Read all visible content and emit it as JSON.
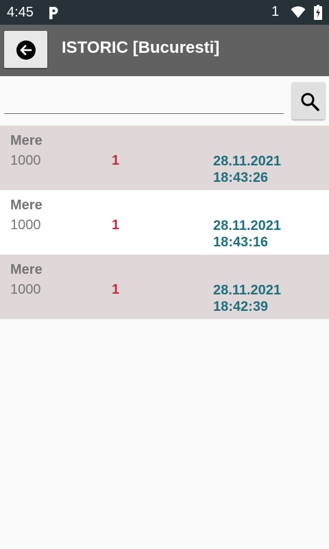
{
  "status_bar": {
    "time": "4:45",
    "sim_label": "1",
    "icons": [
      "p-icon",
      "wifi-icon",
      "battery-icon"
    ]
  },
  "app_bar": {
    "title": "ISTORIC [Bucuresti]",
    "back_icon": "arrow-left-circle-icon"
  },
  "search": {
    "value": "",
    "placeholder": "",
    "button_icon": "search-icon"
  },
  "history": [
    {
      "name": "Mere",
      "code": "1000",
      "qty": "1",
      "date": "28.11.2021",
      "time": "18:43:26"
    },
    {
      "name": "Mere",
      "code": "1000",
      "qty": "1",
      "date": "28.11.2021",
      "time": "18:43:16"
    },
    {
      "name": "Mere",
      "code": "1000",
      "qty": "1",
      "date": "28.11.2021",
      "time": "18:42:39"
    }
  ],
  "colors": {
    "status_bar": "#263238",
    "app_bar": "#616161",
    "row_shaded": "#e0d8d8",
    "row_plain": "#ffffff",
    "qty": "#c62842",
    "datetime": "#1e6f80",
    "label": "#757575"
  }
}
